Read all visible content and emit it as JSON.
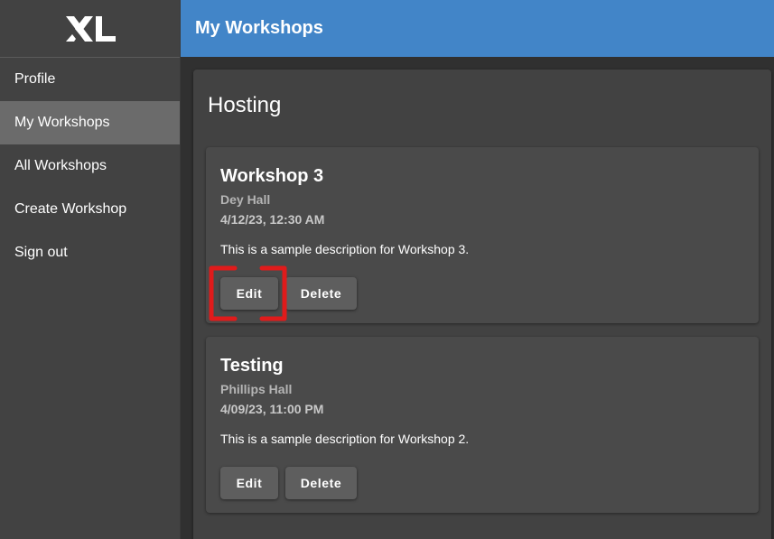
{
  "app": {
    "logo_text": "XL"
  },
  "header": {
    "title": "My Workshops"
  },
  "sidebar": {
    "items": [
      {
        "label": "Profile",
        "active": false
      },
      {
        "label": "My Workshops",
        "active": true
      },
      {
        "label": "All Workshops",
        "active": false
      },
      {
        "label": "Create Workshop",
        "active": false
      },
      {
        "label": "Sign out",
        "active": false
      }
    ]
  },
  "main": {
    "section_title": "Hosting",
    "workshops": [
      {
        "title": "Workshop 3",
        "location": "Dey Hall",
        "datetime": "4/12/23, 12:30 AM",
        "description": "This is a sample description for Workshop 3.",
        "edit_label": "Edit",
        "delete_label": "Delete"
      },
      {
        "title": "Testing",
        "location": "Phillips Hall",
        "datetime": "4/09/23, 11:00 PM",
        "description": "This is a sample description for Workshop 2.",
        "edit_label": "Edit",
        "delete_label": "Delete"
      }
    ]
  },
  "colors": {
    "header_bg": "#4285c8",
    "sidebar_bg": "#424242",
    "active_item_bg": "#6b6b6b",
    "highlight": "#e01b1b"
  }
}
